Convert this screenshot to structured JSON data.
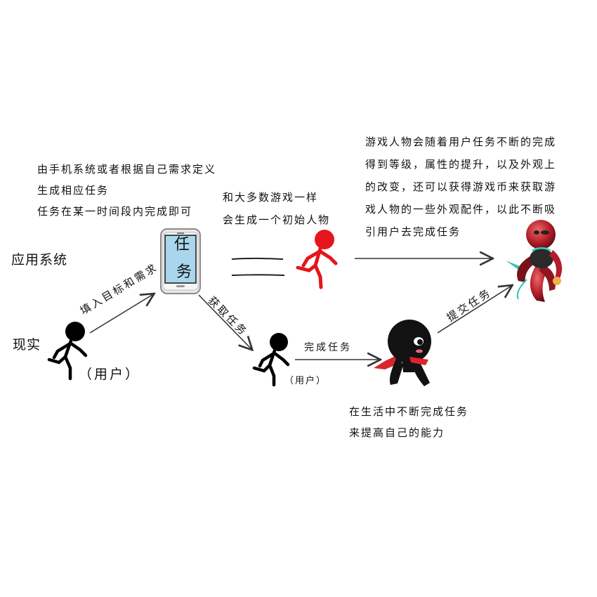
{
  "labels": {
    "app_system": "应用系统",
    "reality": "现实",
    "user_1": "（用户）",
    "user_2": "（用户）"
  },
  "notes": {
    "task_note": [
      "由手机系统或者根据自己需求定义",
      "生成相应任务",
      "任务在某一时间段内完成即可"
    ],
    "character_note": [
      "和大多数游戏一样",
      "会生成一个初始人物"
    ],
    "growth_note": [
      "游戏人物会随着用户任务不断的完成",
      "得到等级，属性的提升，以及外观上",
      "的改变，还可以获得游戏币来获取游",
      "戏人物的一些外观配件，以此不断吸",
      "引用户去完成任务"
    ],
    "life_note": [
      "在生活中不断完成任务",
      "来提高自己的能力"
    ]
  },
  "arrows": {
    "fill_goals": "填入目标和需求",
    "get_task": "获取任务",
    "complete_task": "完成任务",
    "submit_task": "提交任务"
  },
  "phone": {
    "char_1": "任",
    "char_2": "务"
  },
  "equals_sign": "二",
  "colors": {
    "ink": "#111111",
    "red": "#e4161b",
    "scarf": "#d9242b",
    "phone_screen": "#a9d6ec"
  }
}
